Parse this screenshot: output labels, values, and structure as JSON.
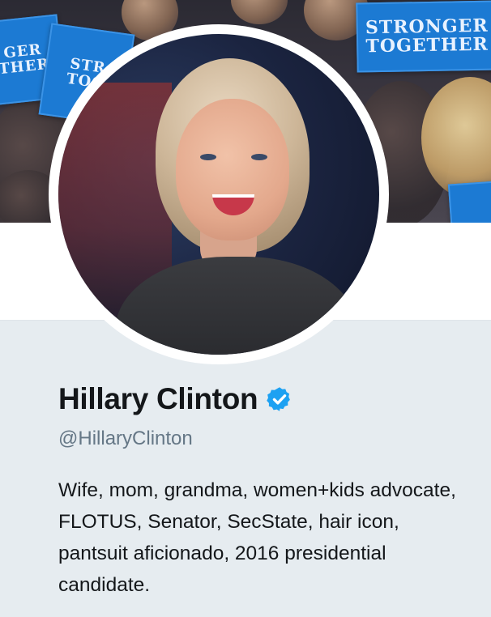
{
  "banner": {
    "signs": [
      {
        "lines": [
          "STRONGER",
          "TOGETHER"
        ]
      },
      {
        "lines": [
          "GER",
          "THER"
        ]
      },
      {
        "lines": [
          "STR",
          "TOG"
        ]
      }
    ],
    "icon": "crowd-rally-photo"
  },
  "profile": {
    "avatar_icon": "profile-photo",
    "display_name": "Hillary Clinton",
    "verified_icon": "verified-badge-icon",
    "handle": "@HillaryClinton",
    "bio": "Wife, mom, grandma, women+kids advocate, FLOTUS, Senator, SecState, hair icon, pantsuit aficionado, 2016 presidential candidate."
  },
  "colors": {
    "verified_blue": "#1da1f2",
    "sign_blue": "#1c7ad3",
    "background": "#e6ecf0",
    "text_primary": "#14171a",
    "text_secondary": "#657786"
  }
}
